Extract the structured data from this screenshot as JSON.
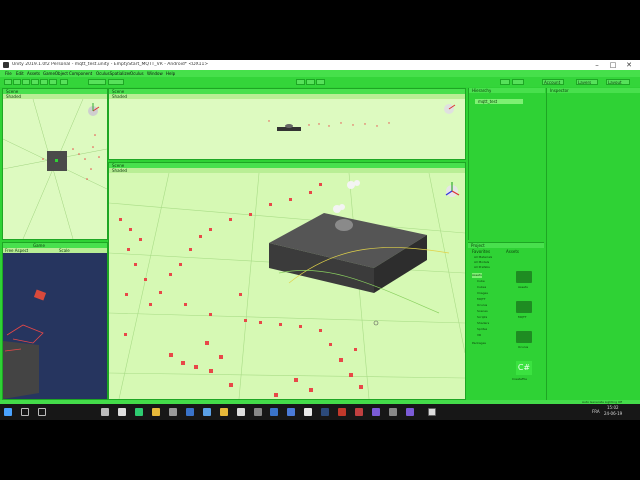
{
  "window": {
    "title": "Unity 2019.1.0f2 Personal - mqtt_test.unity - EmptyStart_MQTT_VR - Android* <DX11>",
    "controls": [
      "–",
      "□",
      "✕"
    ]
  },
  "menu": [
    "File",
    "Edit",
    "Assets",
    "GameObject",
    "Component",
    "OculusSpatializer",
    "Oculus",
    "Window",
    "Help"
  ],
  "toolbar": {
    "account_label": "Account",
    "layers_label": "Layers",
    "layout_label": "Layout"
  },
  "views": {
    "left_top_tab": "Scene",
    "left_top_mode": "Shaded",
    "top_center_tab": "Scene",
    "top_center_mode": "Shaded",
    "main_tab": "Scene",
    "main_mode": "Shaded",
    "game_tab": "Game",
    "game_display": "Free Aspect",
    "game_scale": "Scale"
  },
  "hierarchy": {
    "tab": "Hierarchy",
    "item": "mqtt_test"
  },
  "inspector": {
    "tab": "Inspector"
  },
  "project": {
    "tab": "Project",
    "breadcrumb_root": "Assets",
    "favorites": "Favorites",
    "tree": [
      "All Materials",
      "All Models",
      "All Prefabs",
      "Assets",
      "Cube",
      "Cubes",
      "Images",
      "MQTT",
      "Oculus",
      "Scenes",
      "Scripts",
      "Shaders",
      "Sprites",
      "VR",
      "Packages"
    ],
    "assets": [
      {
        "name": "Assets",
        "kind": "folder"
      },
      {
        "name": "MQTT",
        "kind": "folder"
      },
      {
        "name": "Oculus",
        "kind": "folder"
      },
      {
        "name": "CreateFile",
        "kind": "script"
      }
    ],
    "status": "Auto Generate Lighting Off"
  },
  "taskbar": {
    "lang": "FRA",
    "time": "15:02",
    "date": "24-06-19"
  },
  "colors": {
    "ui_green": "#2fd235",
    "panel_green": "#cdf6a9",
    "trail_red": "#e84848",
    "cube_dark": "#3b3b3b"
  }
}
